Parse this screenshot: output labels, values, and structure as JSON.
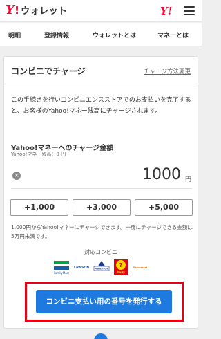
{
  "header": {
    "logo_y": "Y",
    "logo_bang": "!",
    "logo_text": "ウォレット",
    "yahoo_mark": "Y!"
  },
  "nav": {
    "items": [
      "明細",
      "登録情報",
      "ウォレットとは",
      "マネーとは"
    ]
  },
  "card": {
    "title": "コンビニでチャージ",
    "link": "チャージ方法変更",
    "description": "この手続きを行いコンビニエンスストアでのお支払いを完了すると、お客様のYahoo!マネー残高にチャージされます。",
    "amount_title": "Yahoo!マネーへのチャージ金額",
    "amount_sub": "Yahoo!マネー残高：0 円",
    "clear_icon": "×",
    "amount_value": "1000",
    "amount_unit": "円",
    "add_buttons": [
      "+1,000",
      "+3,000",
      "+5,000"
    ],
    "note": "1,000円からYahoo!マネーにチャージできます。一度にチャージできる金額は5万円未満です。",
    "supported_title": "対応コンビニ",
    "stores": [
      "FamilyMart",
      "LAWSON",
      "MINISTOP",
      "Daily",
      "Seicomart"
    ],
    "issue_button": "コンビニ支払い用の番号を発行する"
  },
  "colors": {
    "brand_red": "#ff0033",
    "primary_blue": "#1f7ae0",
    "highlight_red": "#e60012"
  }
}
